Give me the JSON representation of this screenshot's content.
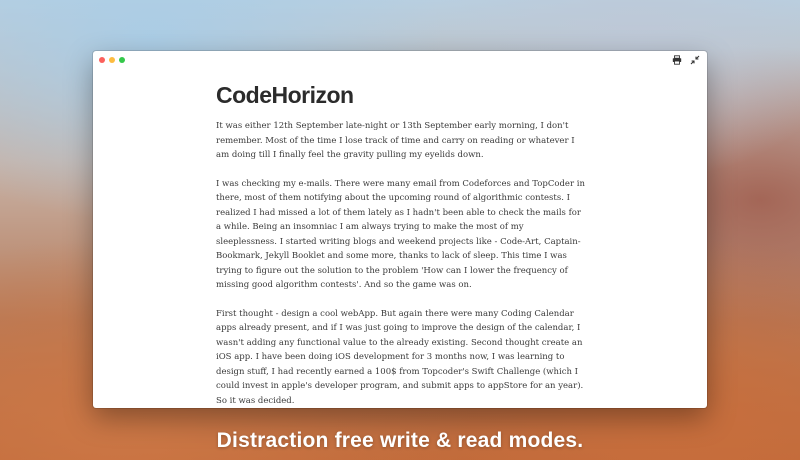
{
  "window": {
    "controls": [
      "close",
      "minimize",
      "zoom"
    ],
    "icons": [
      "print-icon",
      "exit-fullscreen-icon"
    ]
  },
  "document": {
    "title": "CodeHorizon",
    "paragraphs": [
      "It was either 12th September late-night or 13th September early morning, I don't remember. Most of the time I lose track of time and carry on reading or whatever I am doing till I finally feel the gravity pulling my eyelids down.",
      "I was checking my e-mails. There were many email from Codeforces and TopCoder in there, most of them notifying about the upcoming round of algorithmic contests. I realized I had missed a lot of them lately as I hadn't been able to check the mails for a while. Being an insomniac I am always trying to make the most of my sleeplessness. I started writing blogs and weekend projects like - Code-Art, Captain-Bookmark, Jekyll Booklet and some more, thanks to lack of sleep. This time I was trying to figure out the solution to the problem 'How can I lower the frequency of missing good algorithm contests'. And so the game was on.",
      "First thought - design a cool webApp. But again there were many Coding Calendar apps already present, and if I was just going to improve the design of the calendar, I wasn't adding any functional value to the already existing. Second thought create an iOS app. I have been doing iOS development for 3 months now, I was learning to design stuff, I had recently earned a 100$ from Topcoder's Swift Challenge (which I could invest in apple's developer program, and submit apps to appStore for an year). So it was decided."
    ]
  },
  "caption": "Distraction free write & read modes."
}
